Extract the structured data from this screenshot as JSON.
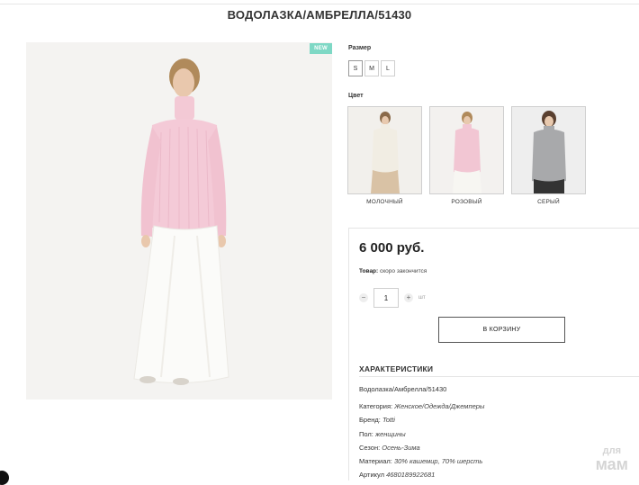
{
  "product": {
    "title": "ВОДОЛАЗКА/АМБРЕЛЛА/51430",
    "badge": "NEW"
  },
  "size": {
    "label": "Размер",
    "options": [
      "S",
      "M",
      "L"
    ]
  },
  "color": {
    "label": "Цвет",
    "options": [
      {
        "name": "МОЛОЧНЫЙ",
        "sweater": "#f1ede3",
        "skirt": "#d9c2a5"
      },
      {
        "name": "РОЗОВЫЙ",
        "sweater": "#f2c6d3",
        "skirt": "#f7f6f2"
      },
      {
        "name": "СЕРЫЙ",
        "sweater": "#a8a9ab",
        "skirt": "#333333"
      }
    ]
  },
  "buy": {
    "price": "6 000 руб.",
    "stock_label": "Товар:",
    "stock_value": "скоро закончится",
    "quantity": "1",
    "unit": "шт",
    "minus": "−",
    "plus": "+",
    "cart_button": "В КОРЗИНУ"
  },
  "specs": {
    "heading": "ХАРАКТЕРИСТИКИ",
    "name": "Водолазка/Амбрелла/51430",
    "rows": [
      {
        "key": "Категория:",
        "value": "Женское/Одежда/Джемперы"
      },
      {
        "key": "Бренд:",
        "value": "Totti"
      },
      {
        "key": "Пол:",
        "value": "женщины"
      },
      {
        "key": "Сезон:",
        "value": "Осень-Зима"
      },
      {
        "key": "Материал:",
        "value": "30% кашемир, 70% шерсть"
      },
      {
        "key": "Артикул",
        "value": "4680189922681"
      }
    ]
  },
  "watermark": {
    "line1": "для",
    "line2": "мам"
  },
  "colors": {
    "badge": "#7ed8c5",
    "border": "#cfcfcf"
  }
}
